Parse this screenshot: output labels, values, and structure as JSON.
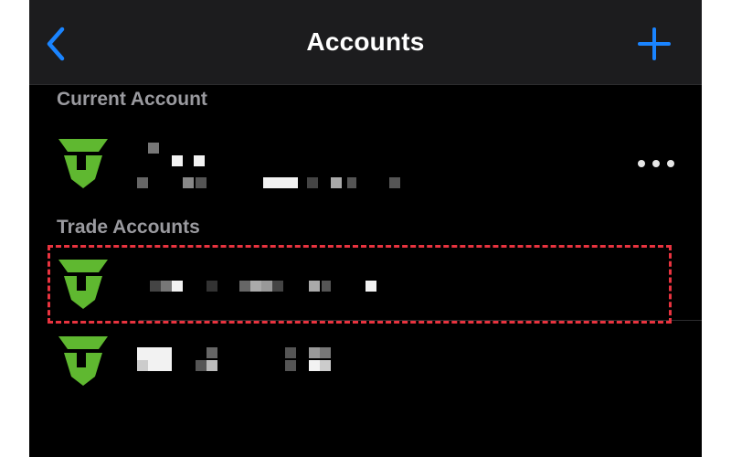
{
  "navbar": {
    "title": "Accounts",
    "back_icon": "chevron-left-icon",
    "add_icon": "plus-icon",
    "accent": "#1a84ff"
  },
  "sections": {
    "current_header": "Current Account",
    "trade_header": "Trade Accounts"
  },
  "accounts": {
    "logo_icon": "shield-t-logo-icon",
    "logo_color": "#5fb830",
    "current_more_icon": "ellipsis-icon",
    "highlight_color": "#e8333f"
  }
}
